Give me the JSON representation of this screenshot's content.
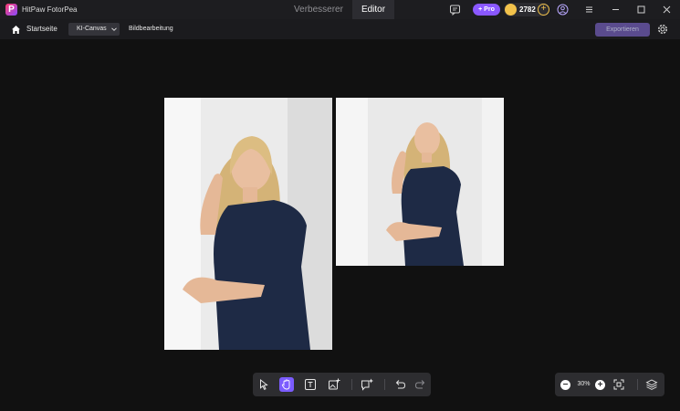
{
  "app": {
    "logo_letter": "P",
    "title": "HitPaw FotorPea"
  },
  "mode_tabs": [
    {
      "label": "Verbesserer"
    },
    {
      "label": "Editor"
    }
  ],
  "account": {
    "pro_label": "+ Pro",
    "coins": "2782",
    "coin_plus": "+"
  },
  "nav": {
    "home_label": "Startseite",
    "canvas_dropdown": "KI-Canvas",
    "edit_label": "Bildbearbeitung",
    "export_label": "Exportieren"
  },
  "zoom": {
    "level": "30%",
    "minus": "−",
    "plus": "+"
  },
  "colors": {
    "accent": "#7b5cff",
    "pro": "#8a58ff",
    "coin": "#f2c24b",
    "canvas": "#111111",
    "dress": "#1e2a45"
  }
}
